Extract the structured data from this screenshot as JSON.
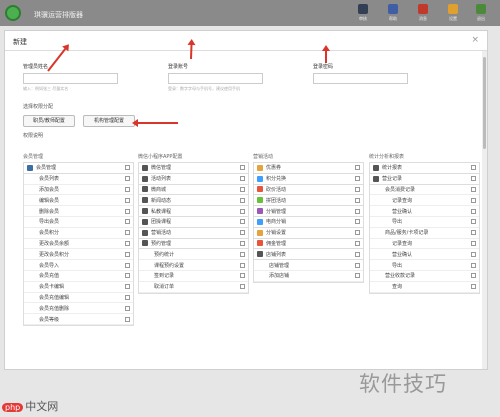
{
  "app": {
    "title": "琪骥运营排版器"
  },
  "toolbar": [
    {
      "label": "审核",
      "color": "#333f55",
      "icon": "question-icon"
    },
    {
      "label": "帮助",
      "color": "#3f5ea5",
      "icon": "help-icon"
    },
    {
      "label": "消息",
      "color": "#c0392b",
      "icon": "message-icon"
    },
    {
      "label": "设置",
      "color": "#e0a030",
      "icon": "settings-icon"
    },
    {
      "label": "退出",
      "color": "#4a8a3a",
      "icon": "exit-icon"
    }
  ],
  "modal": {
    "title": "新建",
    "close": "×"
  },
  "form": {
    "fields": [
      {
        "label": "管理员姓名",
        "hint": "输入：例如张三  尽量实名"
      },
      {
        "label": "登录账号",
        "hint": "登录：数字字母与手机号，建议使用手机"
      },
      {
        "label": "登录密码",
        "hint": ""
      }
    ],
    "section_role": "选择权限分配",
    "btn_staff": "职员/教师配置",
    "btn_agency": "机构管理配置",
    "section_perm": "权限说明"
  },
  "columns": [
    {
      "title": "会员管理",
      "items": [
        {
          "label": "会员管理",
          "lvl": 0,
          "icon": "#3a6ea5"
        },
        {
          "label": "会员列表",
          "lvl": 1
        },
        {
          "label": "添加会员",
          "lvl": 1
        },
        {
          "label": "编辑会员",
          "lvl": 1
        },
        {
          "label": "删除会员",
          "lvl": 1
        },
        {
          "label": "导出会员",
          "lvl": 1
        },
        {
          "label": "会员积分",
          "lvl": 1
        },
        {
          "label": "更改会员余额",
          "lvl": 1
        },
        {
          "label": "更改会员积分",
          "lvl": 1
        },
        {
          "label": "会员导入",
          "lvl": 1
        },
        {
          "label": "会员充值",
          "lvl": 1
        },
        {
          "label": "会员卡编辑",
          "lvl": 1
        },
        {
          "label": "会员充值编辑",
          "lvl": 1
        },
        {
          "label": "会员充值删除",
          "lvl": 1
        },
        {
          "label": "会员等级",
          "lvl": 1
        }
      ]
    },
    {
      "title": "微信小程序APP配置",
      "items": [
        {
          "label": "微信管理",
          "lvl": 0,
          "icon": "#555555"
        },
        {
          "label": "活动列表",
          "lvl": 0,
          "icon": "#555555"
        },
        {
          "label": "微商城",
          "lvl": 0,
          "icon": "#555555"
        },
        {
          "label": "新闻动态",
          "lvl": 0,
          "icon": "#555555"
        },
        {
          "label": "私教课程",
          "lvl": 0,
          "icon": "#555555"
        },
        {
          "label": "团操课程",
          "lvl": 0,
          "icon": "#555555"
        },
        {
          "label": "营销活动",
          "lvl": 0,
          "icon": "#555555"
        },
        {
          "label": "预约管理",
          "lvl": 0,
          "icon": "#555555"
        },
        {
          "label": "预约统计",
          "lvl": 1
        },
        {
          "label": "课程预约设置",
          "lvl": 1
        },
        {
          "label": "签到记录",
          "lvl": 1
        },
        {
          "label": "取消订单",
          "lvl": 1
        }
      ]
    },
    {
      "title": "营销活动",
      "items": [
        {
          "label": "优惠券",
          "lvl": 0,
          "icon": "#e6a23c"
        },
        {
          "label": "积分兑换",
          "lvl": 0,
          "icon": "#409eff"
        },
        {
          "label": "砍价活动",
          "lvl": 0,
          "icon": "#e6553c"
        },
        {
          "label": "拼团活动",
          "lvl": 0,
          "icon": "#67c23a"
        },
        {
          "label": "分销管理",
          "lvl": 0,
          "icon": "#9b59b6"
        },
        {
          "label": "电商分销",
          "lvl": 0,
          "icon": "#409eff"
        },
        {
          "label": "分销设置",
          "lvl": 0,
          "icon": "#e6a23c"
        },
        {
          "label": "佣金管理",
          "lvl": 0,
          "icon": "#e6553c"
        },
        {
          "label": "店铺列表",
          "lvl": 0,
          "icon": "#555555"
        },
        {
          "label": "店铺管理",
          "lvl": 1
        },
        {
          "label": "添加店铺",
          "lvl": 1
        }
      ]
    },
    {
      "title": "统计分析和报表",
      "items": [
        {
          "label": "统计报表",
          "lvl": 0,
          "icon": "#555555"
        },
        {
          "label": "营业记录",
          "lvl": 0,
          "icon": "#555555"
        },
        {
          "label": "会员消费记录",
          "lvl": 1
        },
        {
          "label": "记录查询",
          "lvl": 2
        },
        {
          "label": "营业确认",
          "lvl": 2
        },
        {
          "label": "导出",
          "lvl": 2
        },
        {
          "label": "商品/服务/卡项记录",
          "lvl": 1
        },
        {
          "label": "记录查询",
          "lvl": 2
        },
        {
          "label": "营业确认",
          "lvl": 2
        },
        {
          "label": "导出",
          "lvl": 2
        },
        {
          "label": "营业收款记录",
          "lvl": 1
        },
        {
          "label": "查询",
          "lvl": 2
        }
      ]
    }
  ],
  "watermark": {
    "site": "软件技巧",
    "brand_badge": "php",
    "brand_text": "中文网"
  }
}
